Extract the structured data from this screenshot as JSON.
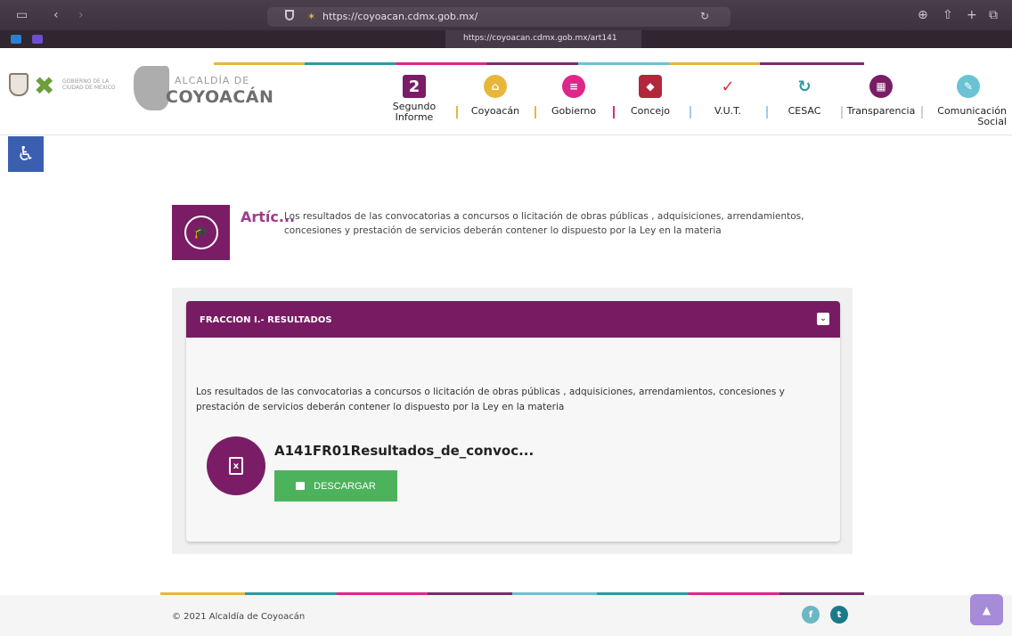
{
  "browser": {
    "url": "https://coyoacan.cdmx.gob.mx/",
    "tab_url": "https://coyoacan.cdmx.gob.mx/art141"
  },
  "header": {
    "gob_logo_text": "GOBIERNO DE LA CIUDAD DE MÉXICO",
    "alcaldia_small": "ALCALDÍA DE",
    "alcaldia_name": "COYOACÁN",
    "nav": [
      {
        "label": "Segundo Informe",
        "icon": "2",
        "color": "#7a1d66",
        "icon_name": "segundo-informe-icon"
      },
      {
        "label": "Coyoacán",
        "icon": "⌂",
        "color": "#e8b63a",
        "icon_name": "home-icon"
      },
      {
        "label": "Gobierno",
        "icon": "≡",
        "color": "#e0268a",
        "icon_name": "list-icon"
      },
      {
        "label": "Concejo",
        "icon": "◆",
        "color": "#b2273b",
        "icon_name": "concejo-crest-icon"
      },
      {
        "label": "V.U.T.",
        "icon": "✓",
        "color": "#d9323c",
        "icon_name": "vut-icon"
      },
      {
        "label": "CESAC",
        "icon": "↻",
        "color": "#2b9aa3",
        "icon_name": "cesac-icon"
      },
      {
        "label": "Transparencia",
        "icon": "▦",
        "color": "#7a1d66",
        "icon_name": "calendar-icon"
      },
      {
        "label": "Comunicación Social",
        "icon": "✎",
        "color": "#6bc3d2",
        "icon_name": "edit-icon"
      }
    ]
  },
  "accessibility": {
    "icon": "♿"
  },
  "article": {
    "title": "Artíc...",
    "description": "Los resultados de las convocatorias a concursos o licitación de obras públicas , adquisiciones, arrendamientos, concesiones y prestación de servicios deberán contener lo dispuesto por la Ley en la materia",
    "icon": "🎓"
  },
  "panel": {
    "header": "FRACCION I.- RESULTADOS",
    "toggle": "⌄",
    "description": "Los resultados de las convocatorias a concursos o licitación de obras públicas , adquisiciones, arrendamientos, concesiones y prestación de servicios deberán contener lo dispuesto por la Ley en la materia",
    "file_name": "A141FR01Resultados_de_convoc...",
    "file_icon": "x",
    "download_label": "DESCARGAR"
  },
  "footer": {
    "copyright": "© 2021 Alcaldía de Coyoacán",
    "facebook_icon": "f",
    "twitter_icon": "t",
    "to_top_icon": "▲"
  }
}
